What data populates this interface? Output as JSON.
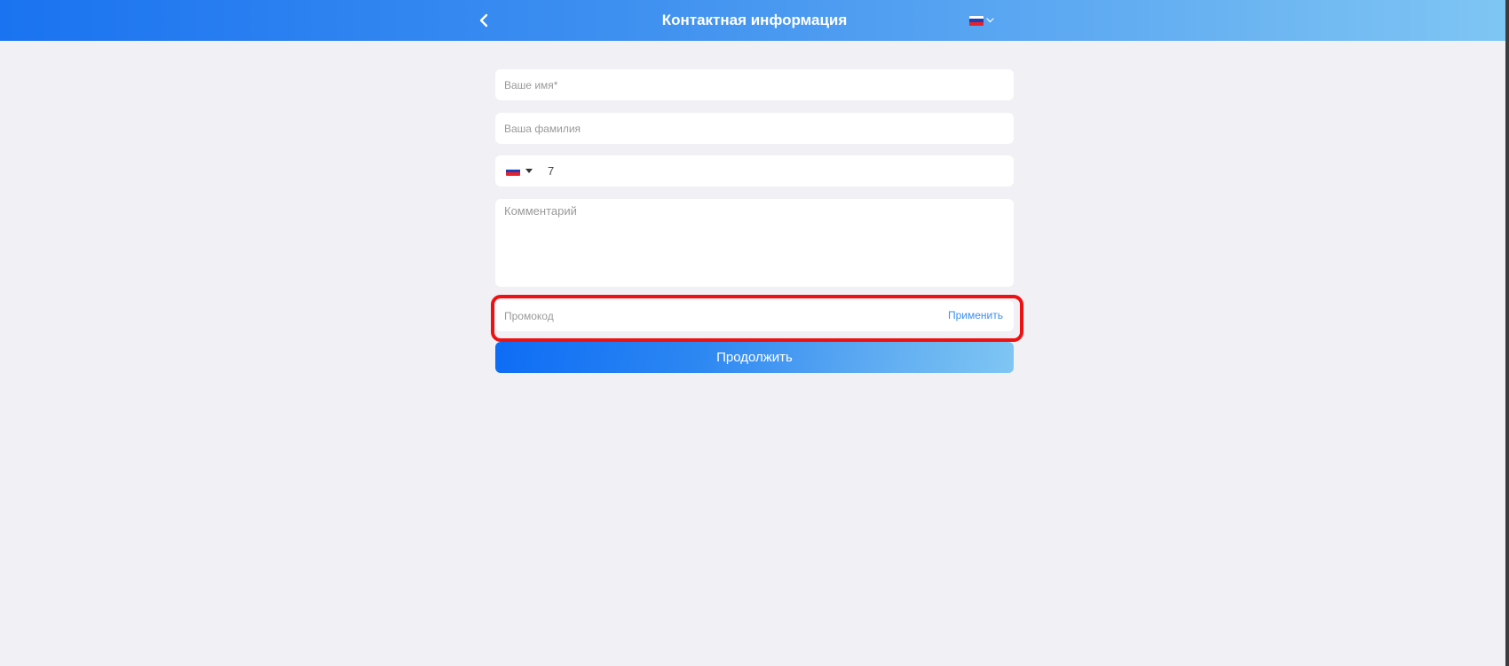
{
  "header": {
    "title": "Контактная информация",
    "back_icon": "chevron-left-icon",
    "language_flag": "russia-flag",
    "language_chevron_icon": "chevron-down-icon"
  },
  "form": {
    "first_name_placeholder": "Ваше имя*",
    "last_name_placeholder": "Ваша фамилия",
    "phone": {
      "country_flag": "russia-flag",
      "value": "7"
    },
    "comment_placeholder": "Комментарий",
    "promo_placeholder": "Промокод",
    "promo_apply_label": "Применить",
    "continue_label": "Продолжить"
  },
  "colors": {
    "header_gradient_start": "#1a73f0",
    "header_gradient_end": "#7fc6f3",
    "background": "#f0f0f5",
    "link": "#3d8ff0",
    "highlight": "#ee1111"
  }
}
